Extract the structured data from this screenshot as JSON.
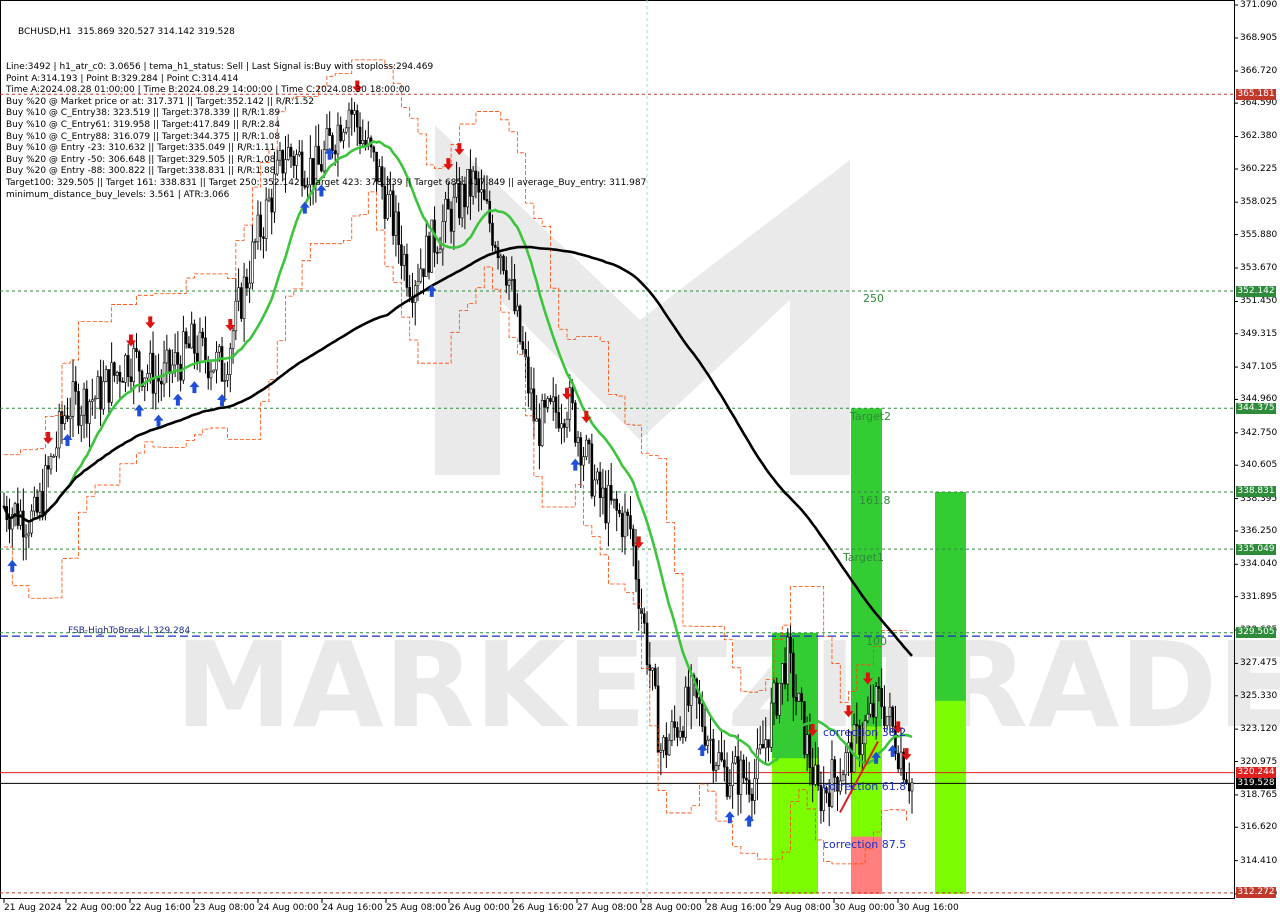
{
  "header": {
    "symbol_line": "BCHUSD,H1  315.869 320.527 314.142 319.528",
    "info_lines": [
      "Line:3492 | h1_atr_c0: 3.0656 | tema_h1_status: Sell | Last Signal is:Buy with stoploss:294.469",
      "Point A:314.193 | Point B:329.284 | Point C:314.414",
      "Time A:2024.08.28 01:00:00 | Time B:2024.08.29 14:00:00 | Time C:2024.08.30 18:00:00",
      "Buy %20 @ Market price or at: 317.371 || Target:352.142 || R/R:1.52",
      "Buy %10 @ C_Entry38: 323.519 || Target:378.339 || R/R:1.89",
      "Buy %10 @ C_Entry61: 319.958 || Target:417.849 || R/R:2.84",
      "Buy %10 @ C_Entry88: 316.079 || Target:344.375 || R/R:1.08",
      "Buy %10 @ Entry -23: 310.632 || Target:335.049 || R/R:1.11",
      "Buy %20 @ Entry -50: 306.648 || Target:329.505 || R/R:1.08",
      "Buy %20 @ Entry -88: 300.822 || Target:338.831 || R/R:1.88",
      "Target100: 329.505 || Target 161: 338.831 || Target 250: 352.142 || Target 423: 378.339 || Target 685: 417.849 || average_Buy_entry: 311.987",
      "minimum_distance_buy_levels: 3.561 | ATR:3.066"
    ]
  },
  "price_axis": {
    "ticks": [
      "371.090",
      "368.905",
      "366.720",
      "364.590",
      "362.380",
      "360.225",
      "358.025",
      "355.880",
      "353.670",
      "351.450",
      "349.315",
      "347.105",
      "344.960",
      "342.750",
      "340.605",
      "338.395",
      "336.250",
      "334.040",
      "331.895",
      "329.685",
      "327.475",
      "325.330",
      "323.120",
      "320.975",
      "318.765",
      "316.620",
      "314.410",
      "312.200"
    ]
  },
  "time_axis": {
    "labels": [
      "21 Aug 2024",
      "22 Aug 00:00",
      "22 Aug 16:00",
      "23 Aug 08:00",
      "24 Aug 00:00",
      "24 Aug 16:00",
      "25 Aug 08:00",
      "26 Aug 00:00",
      "26 Aug 16:00",
      "27 Aug 08:00",
      "28 Aug 00:00",
      "28 Aug 16:00",
      "29 Aug 08:00",
      "30 Aug 00:00",
      "30 Aug 16:00"
    ]
  },
  "levels": [
    {
      "value": "365.181",
      "color": "#c0392b",
      "style": "dashed"
    },
    {
      "value": "352.142",
      "color": "#2e8b3a",
      "style": "dashed"
    },
    {
      "value": "344.375",
      "color": "#2e8b3a",
      "style": "dashed"
    },
    {
      "value": "338.831",
      "color": "#2e8b3a",
      "style": "dashed"
    },
    {
      "value": "335.049",
      "color": "#2e8b3a",
      "style": "dashed"
    },
    {
      "value": "329.505",
      "color": "#2e8b3a",
      "style": "dashed"
    },
    {
      "value": "320.244",
      "color": "#e02020",
      "style": "solid"
    },
    {
      "value": "319.528",
      "color": "#000000",
      "style": "solid"
    },
    {
      "value": "312.272",
      "color": "#c0392b",
      "style": "dashed"
    }
  ],
  "labels": {
    "fsb": "FSB-HighToBreak | 329.284",
    "target_250": "250",
    "target2": "Target2",
    "target_1618": "161.8",
    "target1": "Target1",
    "target_100": "100",
    "correction_382": "correction 38.2",
    "correction_618": "correction 61.8",
    "correction_875": "correction 87.5",
    "watermark": "MARKETZITRADE"
  },
  "colors": {
    "bull_candle": "#000000",
    "bear_candle": "#000000",
    "ma_fast": "#3cc43c",
    "ma_slow": "#000000",
    "channel": "#ff4500",
    "target_zone": "#33cc33",
    "entry_zone": "#7cfc00",
    "stop_zone": "#ff7f7f",
    "buy_arrow": "#1f4fd8",
    "sell_arrow": "#e01010"
  },
  "chart_data": {
    "type": "candlestick",
    "symbol": "BCHUSD",
    "timeframe": "H1",
    "ylim": [
      312.2,
      371.09
    ],
    "ohlc_last": {
      "open": 315.869,
      "high": 320.527,
      "low": 314.142,
      "close": 319.528
    },
    "key_levels": [
      365.181,
      352.142,
      344.375,
      338.831,
      335.049,
      329.505,
      320.244,
      319.528,
      312.272
    ],
    "close_path": [
      [
        "21 Aug 2024",
        337.9
      ],
      [
        "21 Aug 08:00",
        336.9
      ],
      [
        "21 Aug 16:00",
        344.5
      ],
      [
        "22 Aug 00:00",
        345.2
      ],
      [
        "22 Aug 08:00",
        347.8
      ],
      [
        "22 Aug 16:00",
        346.2
      ],
      [
        "23 Aug 00:00",
        348.5
      ],
      [
        "23 Aug 08:00",
        347.0
      ],
      [
        "23 Aug 16:00",
        355.0
      ],
      [
        "24 Aug 00:00",
        361.4
      ],
      [
        "24 Aug 08:00",
        360.1
      ],
      [
        "24 Aug 16:00",
        364.5
      ],
      [
        "25 Aug 00:00",
        359.6
      ],
      [
        "25 Aug 08:00",
        352.8
      ],
      [
        "25 Aug 16:00",
        356.5
      ],
      [
        "26 Aug 00:00",
        359.3
      ],
      [
        "26 Aug 08:00",
        354.3
      ],
      [
        "26 Aug 16:00",
        343.0
      ],
      [
        "27 Aug 00:00",
        344.9
      ],
      [
        "27 Aug 08:00",
        338.5
      ],
      [
        "27 Aug 16:00",
        336.5
      ],
      [
        "28 Aug 00:00",
        321.5
      ],
      [
        "28 Aug 08:00",
        325.3
      ],
      [
        "28 Aug 16:00",
        320.2
      ],
      [
        "29 Aug 00:00",
        319.9
      ],
      [
        "29 Aug 08:00",
        328.0
      ],
      [
        "29 Aug 16:00",
        318.6
      ],
      [
        "30 Aug 00:00",
        321.3
      ],
      [
        "30 Aug 08:00",
        325.2
      ],
      [
        "30 Aug 16:00",
        319.528
      ]
    ]
  }
}
